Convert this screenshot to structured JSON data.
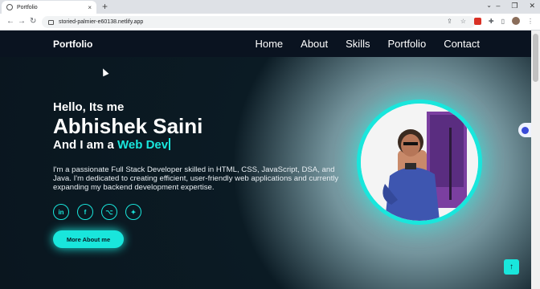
{
  "browser": {
    "tab_title": "Portfolio",
    "tab_close": "×",
    "new_tab": "+",
    "url": "storied-palmier-e60138.netlify.app",
    "back": "←",
    "forward": "→",
    "reload": "↻"
  },
  "nav": {
    "brand": "Portfolio",
    "links": [
      "Home",
      "About",
      "Skills",
      "Portfolio",
      "Contact"
    ]
  },
  "hero": {
    "greeting": "Hello, Its me",
    "name": "Abhishek Saini",
    "role_prefix": "And I am a ",
    "role_highlight": "Web Dev",
    "bio": "I'm a passionate Full Stack Developer skilled in HTML, CSS, JavaScript, DSA, and Java. I'm dedicated to creating efficient, user-friendly web applications and currently expanding my backend development expertise.",
    "cta": "More About me"
  },
  "socials": [
    {
      "icon": "linkedin-icon",
      "glyph": "in"
    },
    {
      "icon": "facebook-icon",
      "glyph": "f"
    },
    {
      "icon": "github-icon",
      "glyph": "⌥"
    },
    {
      "icon": "twitter-icon",
      "glyph": "✦"
    }
  ],
  "scroll_top": "↑",
  "colors": {
    "accent": "#19e6dc",
    "background": "#0b1b24",
    "navbar": "#0a1320"
  }
}
